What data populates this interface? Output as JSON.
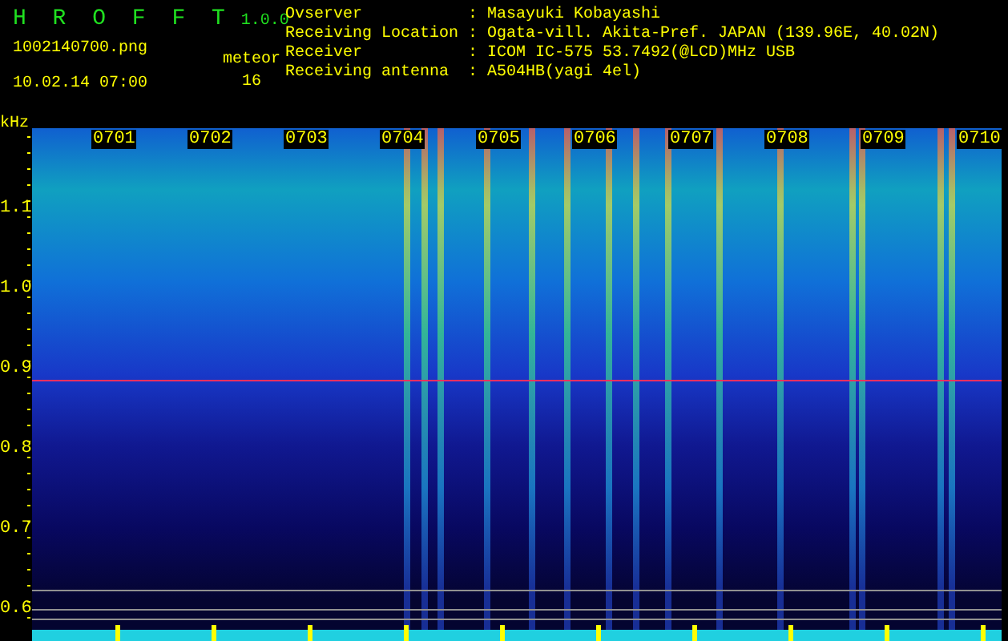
{
  "app": {
    "title": "H R O F F T",
    "version": "1.0.0"
  },
  "file": {
    "name": "1002140700.png",
    "datetime": "10.02.14 07:00"
  },
  "meteor": {
    "label": "meteor",
    "count": "16"
  },
  "info": [
    {
      "label": "Ovserver",
      "separator": ":",
      "value": "Masayuki Kobayashi"
    },
    {
      "label": "Receiving Location",
      "separator": ":",
      "value": "Ogata-vill. Akita-Pref. JAPAN (139.96E, 40.02N)"
    },
    {
      "label": "Receiver",
      "separator": ":",
      "value": "ICOM IC-575 53.7492(@LCD)MHz USB"
    },
    {
      "label": "Receiving antenna",
      "separator": ":",
      "value": "A504HB(yagi 4el)"
    }
  ],
  "y_axis": {
    "unit": "kHz",
    "ticks": [
      "1.1",
      "1.0",
      "0.9",
      "0.8",
      "0.7",
      "0.6"
    ]
  },
  "time_labels": [
    "0701",
    "0702",
    "0703",
    "0704",
    "0705",
    "0706",
    "0707",
    "0708",
    "0709",
    "0710"
  ]
}
